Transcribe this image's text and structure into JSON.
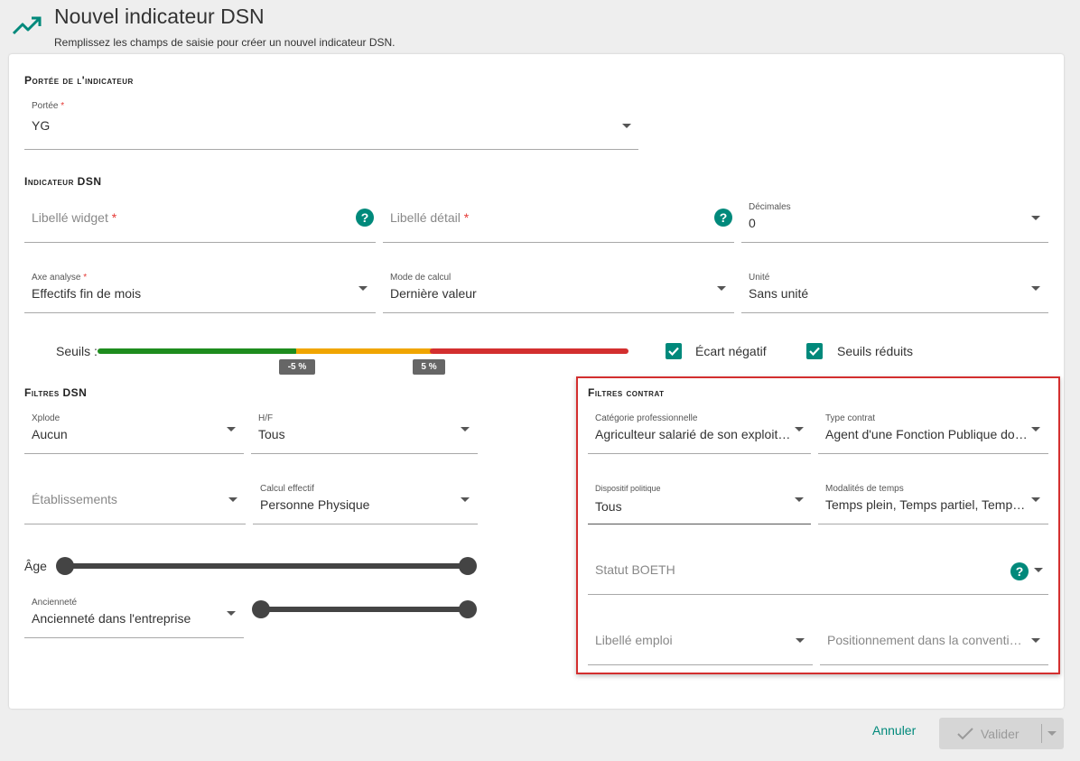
{
  "header": {
    "icon": "trending-up-icon",
    "title": "Nouvel indicateur DSN",
    "subtitle": "Remplissez les champs de saisie pour créer un nouvel indicateur DSN."
  },
  "colors": {
    "accent": "#00897b",
    "required": "#e53935",
    "threshold_green": "#1e8c1e",
    "threshold_orange": "#f0a500",
    "threshold_red": "#d32f2f",
    "highlight_box": "#d32f2f"
  },
  "portee_section": {
    "title": "Portée de l'indicateur",
    "portee": {
      "label": "Portée",
      "required": "*",
      "value": "YG"
    }
  },
  "indicateur_section": {
    "title": "Indicateur DSN",
    "libelle_widget": {
      "placeholder": "Libellé widget",
      "required": "*"
    },
    "libelle_detail": {
      "placeholder": "Libellé détail",
      "required": "*"
    },
    "decimales": {
      "label": "Décimales",
      "value": "0"
    },
    "axe_analyse": {
      "label": "Axe analyse",
      "required": "*",
      "value": "Effectifs fin de mois"
    },
    "mode_calcul": {
      "label": "Mode de calcul",
      "value": "Dernière valeur"
    },
    "unite": {
      "label": "Unité",
      "value": "Sans unité"
    },
    "help_symbol": "?"
  },
  "seuils": {
    "label": "Seuils :",
    "low_label": "-5 %",
    "high_label": "5 %",
    "ecart_negatif": {
      "label": "Écart négatif",
      "checked": true
    },
    "seuils_reduits": {
      "label": "Seuils réduits",
      "checked": true
    }
  },
  "filtres_dsn": {
    "title": "Filtres DSN",
    "xplode": {
      "label": "Xplode",
      "value": "Aucun"
    },
    "hf": {
      "label": "H/F",
      "value": "Tous"
    },
    "etablissements": {
      "placeholder": "Établissements"
    },
    "calcul_effectif": {
      "label": "Calcul effectif",
      "value": "Personne Physique"
    },
    "age": {
      "label": "Âge"
    },
    "anciennete": {
      "label": "Ancienneté",
      "value": "Ancienneté dans l'entreprise"
    }
  },
  "filtres_contrat": {
    "title": "Filtres contrat",
    "categorie": {
      "label": "Catégorie professionnelle",
      "value": "Agriculteur salarié de son exploitation"
    },
    "type_contrat": {
      "label": "Type contrat",
      "value": "Agent d'une Fonction Publique domestique"
    },
    "dispositif": {
      "label": "Dispositif politique",
      "value": "Tous"
    },
    "modalites": {
      "label": "Modalités de temps",
      "value": "Temps plein, Temps partiel, Temps réduit"
    },
    "statut_boeth": {
      "placeholder": "Statut BOETH"
    },
    "libelle_emploi": {
      "placeholder": "Libellé emploi"
    },
    "positionnement": {
      "placeholder": "Positionnement dans la convention collective"
    }
  },
  "footer": {
    "cancel_label": "Annuler",
    "submit_label": "Valider"
  }
}
